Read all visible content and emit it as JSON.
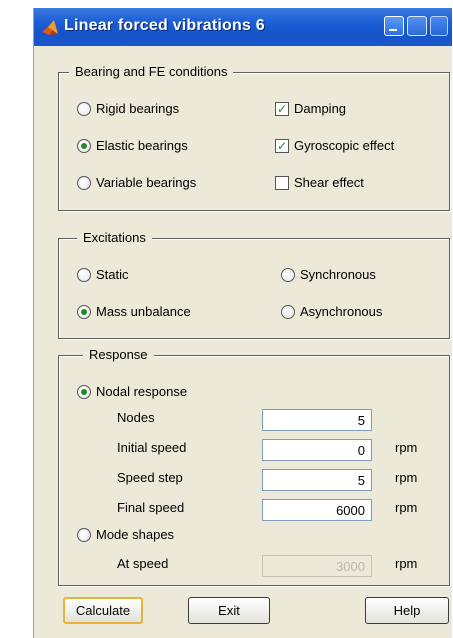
{
  "window": {
    "title": "Linear forced vibrations 6"
  },
  "bearing": {
    "title": "Bearing and FE conditions",
    "options": [
      {
        "label": "Rigid bearings",
        "selected": false
      },
      {
        "label": "Elastic bearings",
        "selected": true
      },
      {
        "label": "Variable bearings",
        "selected": false
      }
    ],
    "checks": [
      {
        "label": "Damping",
        "checked": true
      },
      {
        "label": "Gyroscopic effect",
        "checked": true
      },
      {
        "label": "Shear effect",
        "checked": false
      }
    ]
  },
  "excitations": {
    "title": "Excitations",
    "options": [
      {
        "label": "Static",
        "selected": false
      },
      {
        "label": "Synchronous",
        "selected": false
      },
      {
        "label": "Mass unbalance",
        "selected": true
      },
      {
        "label": "Asynchronous",
        "selected": false
      }
    ]
  },
  "response": {
    "title": "Response",
    "nodal_label": "Nodal response",
    "nodal_selected": true,
    "nodes_label": "Nodes",
    "nodes_value": "5",
    "initial_speed_label": "Initial speed",
    "initial_speed_value": "0",
    "initial_speed_unit": "rpm",
    "speed_step_label": "Speed step",
    "speed_step_value": "5",
    "speed_step_unit": "rpm",
    "final_speed_label": "Final speed",
    "final_speed_value": "6000",
    "final_speed_unit": "rpm",
    "mode_label": "Mode shapes",
    "mode_selected": false,
    "at_speed_label": "At speed",
    "at_speed_value": "3000",
    "at_speed_unit": "rpm"
  },
  "buttons": {
    "calculate": "Calculate",
    "exit": "Exit",
    "help": "Help"
  },
  "colors": {
    "titlebar": "#1d5fd6",
    "window_bg": "#ece9d8",
    "check_mark": "#1f8a2b"
  },
  "icons": {
    "app": "matlab-icon",
    "minimize": "minimize-icon",
    "maximize": "maximize-icon",
    "close": "close-icon"
  }
}
